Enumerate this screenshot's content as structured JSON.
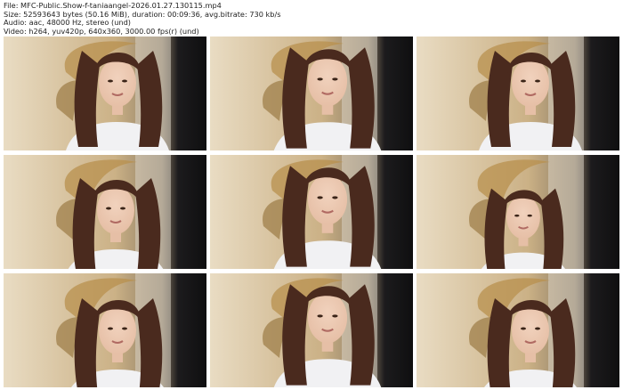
{
  "info": {
    "file": "File: MFC-Public.Show-f-taniaangel-2026.01.27.130115.mp4",
    "size": "Size: 52593643 bytes (50.16 MiB), duration: 00:09:36, avg.bitrate: 730 kb/s",
    "audio": "Audio: aac, 48000 Hz, stereo (und)",
    "video": "Video: h264, yuv420p, 640x360, 3000.00 fps(r) (und)"
  },
  "thumbnails": [
    {
      "variant": "a"
    },
    {
      "variant": "b"
    },
    {
      "variant": "a"
    },
    {
      "variant": "c"
    },
    {
      "variant": "b"
    },
    {
      "variant": "d"
    },
    {
      "variant": "e"
    },
    {
      "variant": "b"
    },
    {
      "variant": "e"
    }
  ],
  "colors": {
    "wall_light": "#e9dcc3",
    "wall_mid": "#cbb186",
    "dark_right": "#1c1b1d",
    "hair": "#4a2a1e",
    "skin": "#e6bfa6",
    "shirt": "#f1f1f3",
    "gold_leaf": "#b8904e"
  }
}
